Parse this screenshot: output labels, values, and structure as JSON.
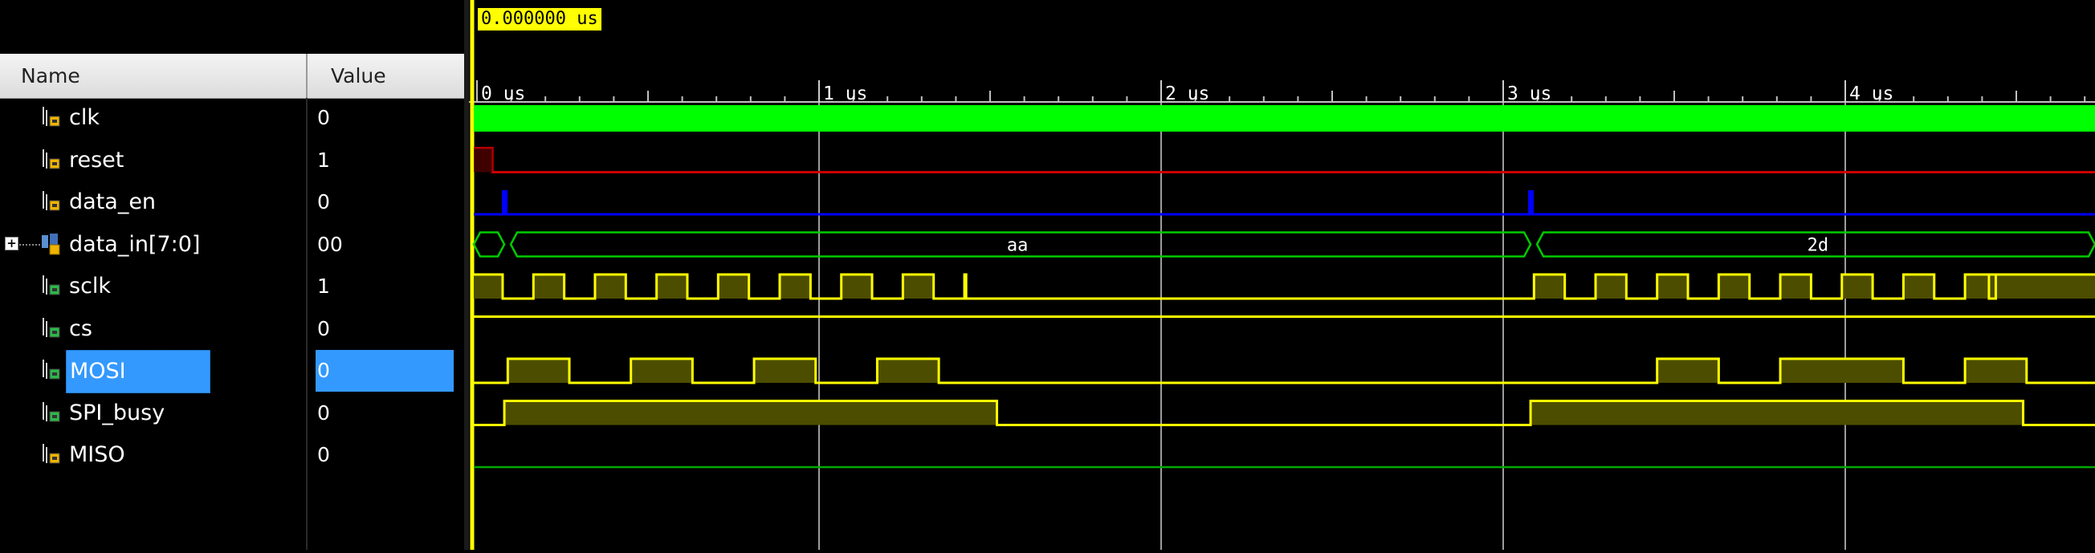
{
  "header": {
    "name_col": "Name",
    "value_col": "Value"
  },
  "cursor": {
    "label": "0.000000 us"
  },
  "ruler": {
    "ticks": [
      "0 us",
      "1 us",
      "2 us",
      "3 us",
      "4 us"
    ]
  },
  "signals": [
    {
      "name": "clk",
      "value": "0",
      "kind": "input-bit"
    },
    {
      "name": "reset",
      "value": "1",
      "kind": "input-bit"
    },
    {
      "name": "data_en",
      "value": "0",
      "kind": "input-bit"
    },
    {
      "name": "data_in[7:0]",
      "value": "00",
      "kind": "bus",
      "bus_values": [
        "aa",
        "2d"
      ]
    },
    {
      "name": "sclk",
      "value": "1",
      "kind": "output-bit"
    },
    {
      "name": "cs",
      "value": "0",
      "kind": "output-bit"
    },
    {
      "name": "MOSI",
      "value": "0",
      "kind": "output-bit",
      "selected": true
    },
    {
      "name": "SPI_busy",
      "value": "0",
      "kind": "output-bit"
    },
    {
      "name": "MISO",
      "value": "0",
      "kind": "input-bit"
    }
  ],
  "colors": {
    "clk": "#00ff00",
    "reset": "#cc0000",
    "data_en": "#0000ff",
    "bus": "#00cc00",
    "trace": "#ffff00",
    "trace_fill": "#4d4d00",
    "miso": "#00aa00",
    "selection": "#3399ff"
  }
}
